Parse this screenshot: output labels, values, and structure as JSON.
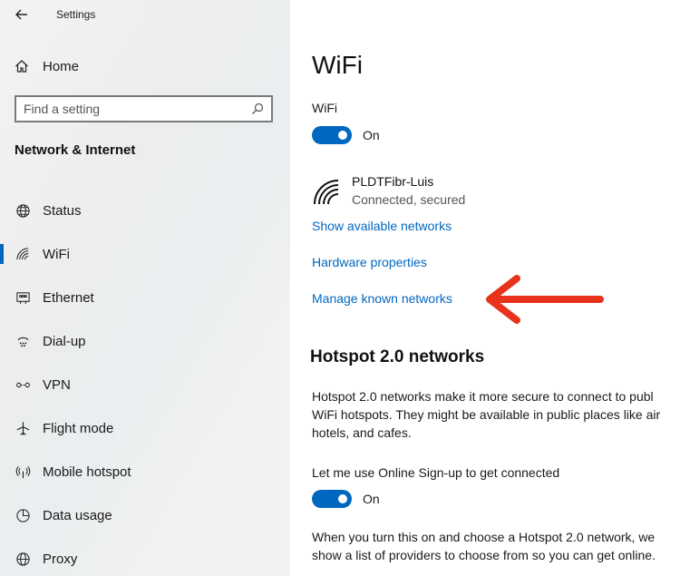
{
  "window": {
    "title": "Settings"
  },
  "sidebar": {
    "home_label": "Home",
    "search": {
      "placeholder": "Find a setting"
    },
    "section_title": "Network & Internet",
    "items": [
      {
        "label": "Status",
        "icon": "globe-icon"
      },
      {
        "label": "WiFi",
        "icon": "wifi-icon",
        "active": true
      },
      {
        "label": "Ethernet",
        "icon": "ethernet-icon"
      },
      {
        "label": "Dial-up",
        "icon": "dialup-icon"
      },
      {
        "label": "VPN",
        "icon": "vpn-icon"
      },
      {
        "label": "Flight mode",
        "icon": "airplane-icon"
      },
      {
        "label": "Mobile hotspot",
        "icon": "hotspot-icon"
      },
      {
        "label": "Data usage",
        "icon": "data-usage-icon"
      },
      {
        "label": "Proxy",
        "icon": "globe-icon"
      }
    ]
  },
  "main": {
    "title": "WiFi",
    "wifi_label": "WiFi",
    "wifi_toggle_state": "On",
    "network": {
      "name": "PLDTFibr-Luis",
      "status": "Connected, secured"
    },
    "links": {
      "show_networks": "Show available networks",
      "hardware_properties": "Hardware properties",
      "manage_known": "Manage known networks"
    },
    "hotspot": {
      "heading": "Hotspot 2.0 networks",
      "description_lines": [
        "Hotspot 2.0 networks make it more secure to connect to publ",
        "WiFi hotspots. They might be available in public places like air",
        "hotels, and cafes."
      ],
      "signup_label": "Let me use Online Sign-up to get connected",
      "signup_toggle_state": "On",
      "footer_lines": [
        "When you turn this on and choose a Hotspot 2.0 network, we",
        "show a list of providers to choose from so you can get online."
      ]
    }
  },
  "colors": {
    "accent": "#0067c0",
    "annotation_arrow": "#e8321c"
  }
}
